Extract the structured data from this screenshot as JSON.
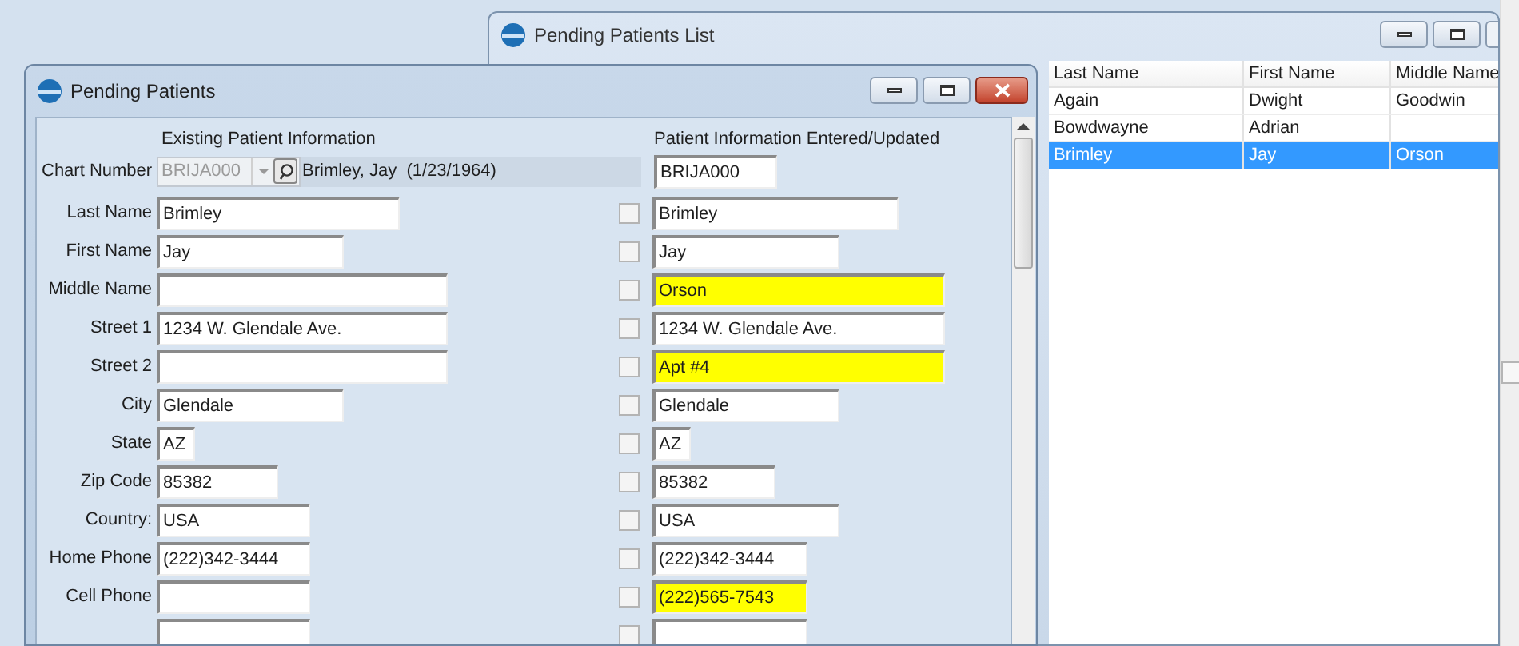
{
  "list_window": {
    "title": "Pending Patients List",
    "columns": [
      "Last Name",
      "First Name",
      "Middle Name"
    ],
    "rows": [
      {
        "cells": [
          "Again",
          "Dwight",
          "Goodwin"
        ],
        "selected": false
      },
      {
        "cells": [
          "Bowdwayne",
          "Adrian",
          null
        ],
        "selected": false
      },
      {
        "cells": [
          "Brimley",
          "Jay",
          "Orson"
        ],
        "selected": true
      }
    ]
  },
  "dialog": {
    "title": "Pending Patients",
    "existing_heading": "Existing Patient Information",
    "entered_heading": "Patient Information Entered/Updated",
    "chart_number": {
      "label": "Chart Number",
      "value": "BRIJA000",
      "patient": "Brimley, Jay  (1/23/1964)",
      "entered": "BRIJA000"
    },
    "fields": [
      {
        "label": "Last Name",
        "existing": "Brimley",
        "entered": "Brimley",
        "checked": false,
        "highlighted": false
      },
      {
        "label": "First Name",
        "existing": "Jay",
        "entered": "Jay",
        "checked": false,
        "highlighted": false
      },
      {
        "label": "Middle Name",
        "entered": "Orson",
        "checked": false,
        "highlighted": true
      },
      {
        "label": "Street 1",
        "existing": "1234 W. Glendale Ave.",
        "entered": "1234 W. Glendale Ave.",
        "checked": false,
        "highlighted": false
      },
      {
        "label": "Street 2",
        "entered": "Apt #4",
        "checked": false,
        "highlighted": true
      },
      {
        "label": "City",
        "existing": "Glendale",
        "entered": "Glendale",
        "checked": false,
        "highlighted": false
      },
      {
        "label": "State",
        "existing": "AZ",
        "entered": "AZ",
        "checked": false,
        "highlighted": false
      },
      {
        "label": "Zip Code",
        "existing": "85382",
        "entered": "85382",
        "checked": false,
        "highlighted": false
      },
      {
        "label": "Country:",
        "existing": "USA",
        "entered": "USA",
        "checked": false,
        "highlighted": false
      },
      {
        "label": "Home Phone",
        "existing": "(222)342-3444",
        "entered": "(222)342-3444",
        "checked": false,
        "highlighted": false
      },
      {
        "label": "Cell Phone",
        "entered": "(222)565-7543",
        "checked": false,
        "highlighted": true
      },
      {
        "checked": false,
        "highlighted": false
      }
    ]
  }
}
